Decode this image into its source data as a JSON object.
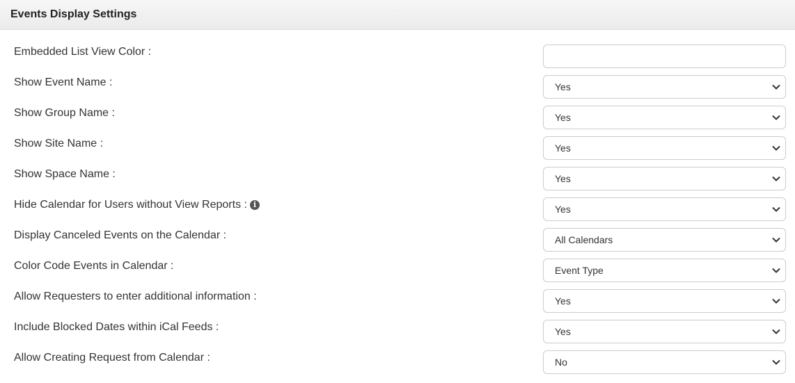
{
  "header": {
    "title": "Events Display Settings"
  },
  "settings": [
    {
      "label": "Embedded List View Color :",
      "type": "text",
      "value": ""
    },
    {
      "label": "Show Event Name :",
      "type": "select",
      "value": "Yes"
    },
    {
      "label": "Show Group Name :",
      "type": "select",
      "value": "Yes"
    },
    {
      "label": "Show Site Name :",
      "type": "select",
      "value": "Yes"
    },
    {
      "label": "Show Space Name :",
      "type": "select",
      "value": "Yes"
    },
    {
      "label": "Hide Calendar for Users without View Reports :",
      "type": "select",
      "value": "Yes",
      "info_icon": "info-circle-icon",
      "info_glyph": "i"
    },
    {
      "label": "Display Canceled Events on the Calendar :",
      "type": "select",
      "value": "All Calendars"
    },
    {
      "label": "Color Code Events in Calendar :",
      "type": "select",
      "value": "Event Type"
    },
    {
      "label": "Allow Requesters to enter additional information :",
      "type": "select",
      "value": "Yes"
    },
    {
      "label": "Include Blocked Dates within iCal Feeds :",
      "type": "select",
      "value": "Yes"
    },
    {
      "label": "Allow Creating Request from Calendar :",
      "type": "select",
      "value": "No"
    }
  ],
  "icons": {
    "select_arrow": "chevron-down-icon"
  },
  "colors": {
    "header_bg": "#efefef",
    "border": "#cccccc",
    "text": "#333333"
  }
}
